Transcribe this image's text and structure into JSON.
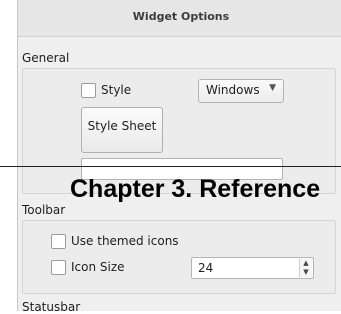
{
  "window": {
    "title": "Widget Options"
  },
  "general": {
    "label": "General",
    "style_checkbox": {
      "label": "Style",
      "checked": false
    },
    "style_combo": {
      "value": "Windows",
      "arrow": "▼"
    },
    "stylesheet_button": {
      "label": "Style Sheet"
    },
    "stylesheet_field": {
      "value": ""
    }
  },
  "toolbar": {
    "label": "Toolbar",
    "themed_icons": {
      "label": "Use themed icons",
      "checked": false
    },
    "icon_size": {
      "label": "Icon Size",
      "checked": false,
      "value": "24"
    }
  },
  "statusbar": {
    "label": "Statusbar"
  },
  "overlay": {
    "heading": "Chapter 3.  Reference"
  }
}
